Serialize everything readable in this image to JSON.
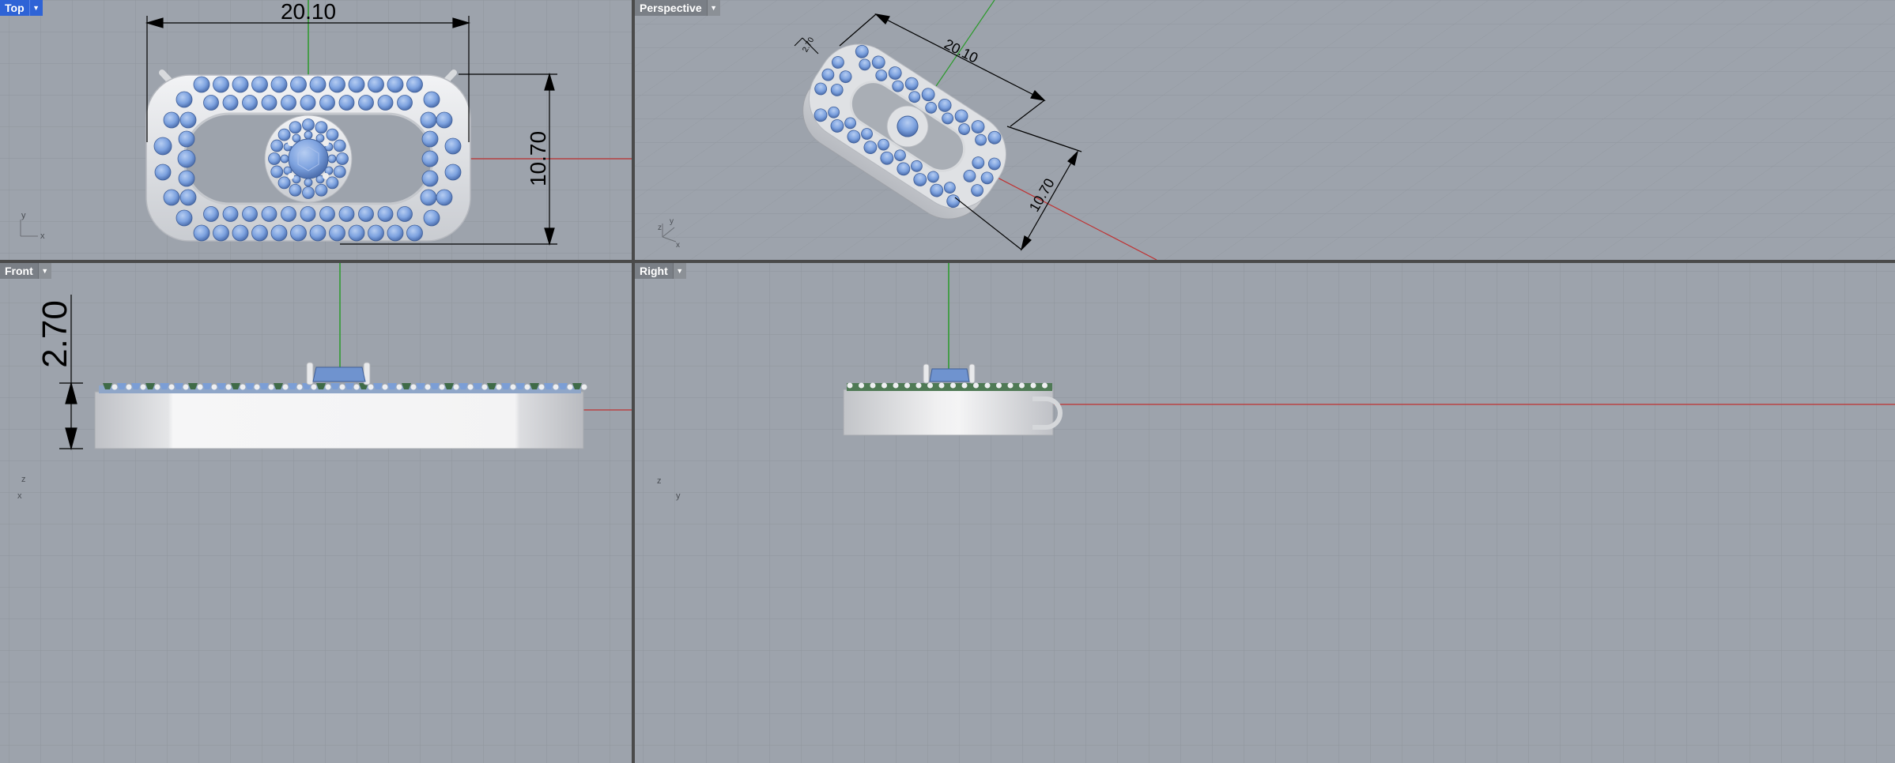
{
  "viewports": {
    "top": {
      "label": "Top",
      "active": true,
      "dims": {
        "width": "20.10",
        "height": "10.70"
      },
      "axes": {
        "a": "y",
        "b": "x"
      }
    },
    "perspective": {
      "label": "Perspective",
      "active": false,
      "dims": {
        "width": "20.10",
        "height": "10.70",
        "depth": "2.70"
      },
      "axes": {
        "a": "z",
        "b": "y",
        "c": "x"
      }
    },
    "front": {
      "label": "Front",
      "active": false,
      "dims": {
        "depth": "2.70"
      },
      "axes": {
        "a": "z",
        "b": "x"
      }
    },
    "right": {
      "label": "Right",
      "active": false,
      "axes": {
        "a": "z",
        "b": "y"
      }
    }
  },
  "menu_icon": "chevron-down-icon",
  "colors": {
    "viewport_bg": "#9da3ac",
    "grid": "#8f959d",
    "active_tab": "#2e63d6",
    "gem": "#7da2df",
    "metal": "#e4e5e8",
    "x_axis": "#c03030",
    "y_axis": "#2a9a2a"
  }
}
